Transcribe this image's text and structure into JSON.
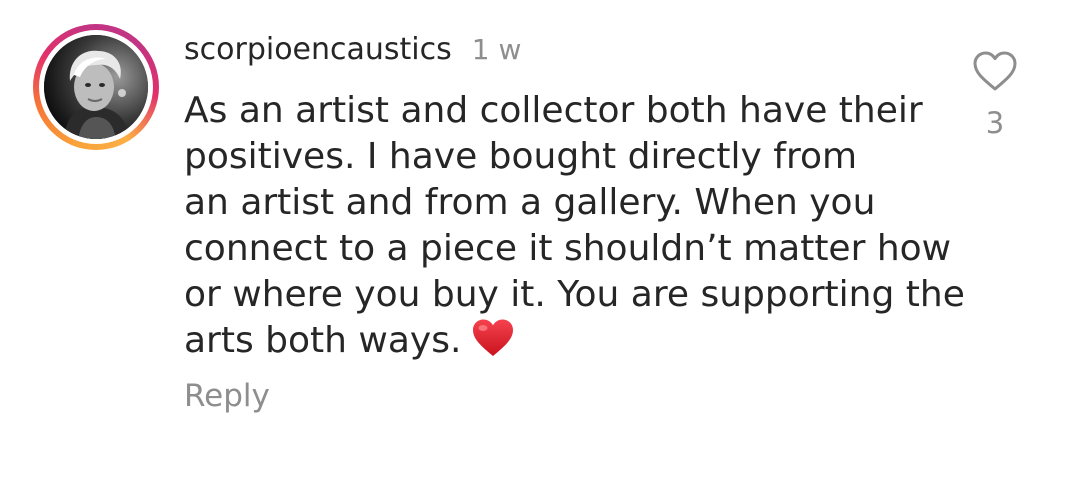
{
  "comment": {
    "username": "scorpioencaustics",
    "time": "1 w",
    "text_lines": [
      "As an artist and collector both have their",
      "positives. I have bought directly from",
      "an artist and from a gallery. When you",
      "connect to a piece it shouldn’t matter how",
      "or where you buy it. You are supporting the",
      "arts both ways."
    ],
    "emoji": "red-heart-emoji",
    "reply_label": "Reply",
    "like_count": "3",
    "like_icon": "heart-outline-icon"
  },
  "colors": {
    "text_primary": "#262626",
    "text_secondary": "#8e8e8e",
    "emoji_red": "#e0242f",
    "story_ring": [
      "#f9a23a",
      "#e1306c",
      "#c13584"
    ]
  }
}
